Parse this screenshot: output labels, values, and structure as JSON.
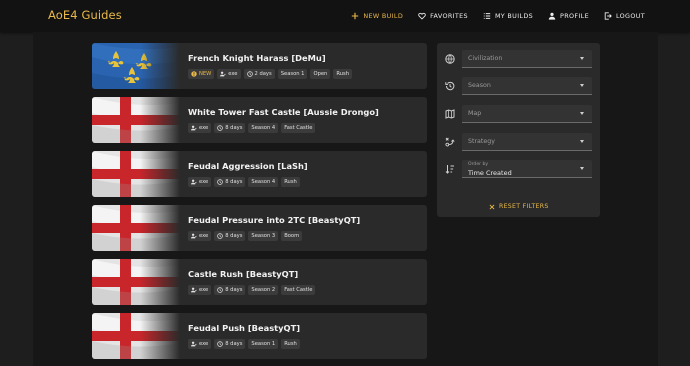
{
  "app": {
    "title": "AoE4 Guides"
  },
  "nav": {
    "new_build": "NEW BUILD",
    "favorites": "FAVORITES",
    "my_builds": "MY BUILDS",
    "profile": "PROFILE",
    "logout": "LOGOUT"
  },
  "builds": [
    {
      "title": "French Knight Harass [DeMu]",
      "flag": "france",
      "is_new": true,
      "new_label": "NEW",
      "author": "exe",
      "age": "2 days",
      "season": "Season 1",
      "tags": [
        "Open",
        "Rush"
      ]
    },
    {
      "title": "White Tower Fast Castle [Aussie Drongo]",
      "flag": "england",
      "is_new": false,
      "author": "exe",
      "age": "8 days",
      "season": "Season 4",
      "tags": [
        "Fast Castle"
      ]
    },
    {
      "title": "Feudal Aggression [LaSh]",
      "flag": "england",
      "is_new": false,
      "author": "exe",
      "age": "8 days",
      "season": "Season 4",
      "tags": [
        "Rush"
      ]
    },
    {
      "title": "Feudal Pressure into 2TC [BeastyQT]",
      "flag": "england",
      "is_new": false,
      "author": "exe",
      "age": "8 days",
      "season": "Season 3",
      "tags": [
        "Boom"
      ]
    },
    {
      "title": "Castle Rush [BeastyQT]",
      "flag": "england",
      "is_new": false,
      "author": "exe",
      "age": "8 days",
      "season": "Season 2",
      "tags": [
        "Fast Castle"
      ]
    },
    {
      "title": "Feudal Push [BeastyQT]",
      "flag": "england",
      "is_new": false,
      "author": "exe",
      "age": "8 days",
      "season": "Season 1",
      "tags": [
        "Rush"
      ]
    }
  ],
  "filters": {
    "civilization": "Civilization",
    "season": "Season",
    "map": "Map",
    "strategy": "Strategy",
    "order_label": "Order by",
    "order_value": "Time Created",
    "reset": "RESET FILTERS"
  },
  "colors": {
    "accent": "#e9b949",
    "card": "#2a2a2a",
    "background": "#171717",
    "topbar": "#121212"
  }
}
